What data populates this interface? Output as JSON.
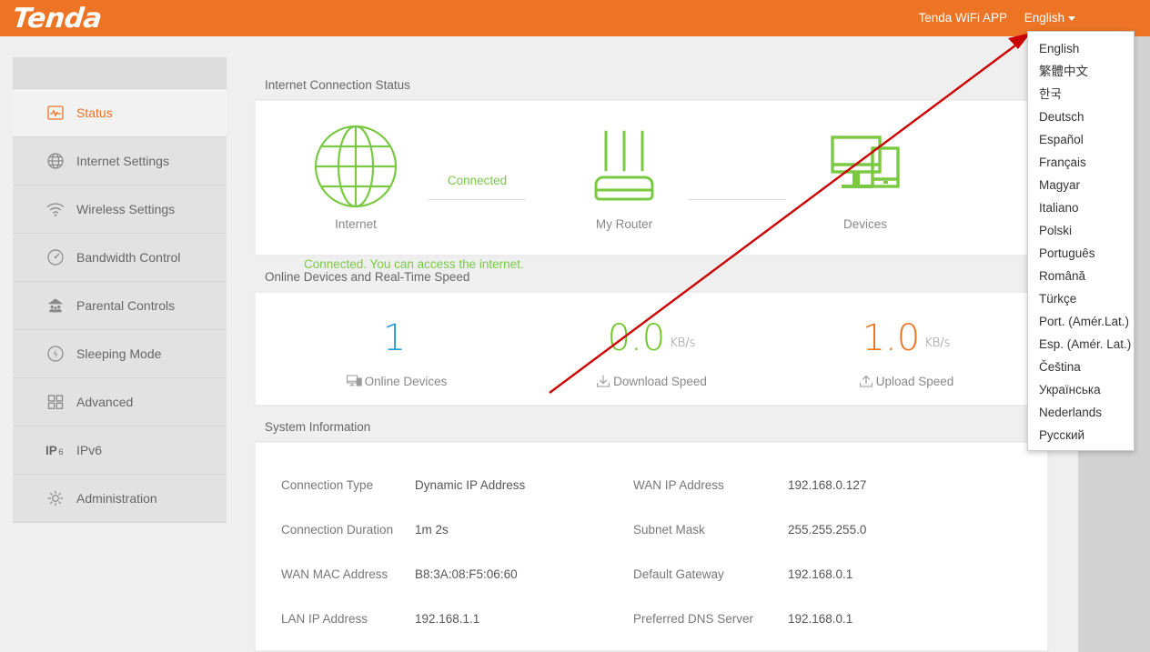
{
  "header": {
    "logo": "Tenda",
    "app_link": "Tenda WiFi APP",
    "language_current": "English"
  },
  "language_menu": {
    "items": [
      "English",
      "繁體中文",
      "한국",
      "Deutsch",
      "Español",
      "Français",
      "Magyar",
      "Italiano",
      "Polski",
      "Português",
      "Română",
      "Türkçe",
      "Port. (Amér.Lat.)",
      "Esp. (Amér. Lat.)",
      "Čeština",
      "Українська",
      "Nederlands",
      "Русский"
    ]
  },
  "sidebar": {
    "items": [
      {
        "label": "Status",
        "icon": "status-chart-icon",
        "active": true
      },
      {
        "label": "Internet Settings",
        "icon": "globe-icon",
        "active": false
      },
      {
        "label": "Wireless Settings",
        "icon": "wifi-icon",
        "active": false
      },
      {
        "label": "Bandwidth Control",
        "icon": "gauge-icon",
        "active": false
      },
      {
        "label": "Parental Controls",
        "icon": "family-icon",
        "active": false
      },
      {
        "label": "Sleeping Mode",
        "icon": "power-moon-icon",
        "active": false
      },
      {
        "label": "Advanced",
        "icon": "grid-squares-icon",
        "active": false
      },
      {
        "label": "IPv6",
        "icon": "ipv6-icon",
        "active": false
      },
      {
        "label": "Administration",
        "icon": "gear-icon",
        "active": false
      }
    ]
  },
  "connection_status": {
    "section_title": "Internet Connection Status",
    "nodes": [
      {
        "label": "Internet",
        "icon": "globe-icon"
      },
      {
        "label": "My Router",
        "icon": "router-icon"
      },
      {
        "label": "Devices",
        "icon": "devices-icon"
      }
    ],
    "link_status": "Connected",
    "note": "Connected. You can access the internet.",
    "accent_color": "#7ac943"
  },
  "realtime": {
    "section_title": "Online Devices and Real-Time Speed",
    "metrics": [
      {
        "value": "1",
        "unit": "",
        "label": "Online Devices",
        "icon": "devices-small-icon",
        "color": "#2b9ad6"
      },
      {
        "value": "0.0",
        "unit": "KB/s",
        "label": "Download Speed",
        "icon": "download-icon",
        "color": "#6fc62a"
      },
      {
        "value": "1.0",
        "unit": "KB/s",
        "label": "Upload Speed",
        "icon": "upload-icon",
        "color": "#ec7424"
      }
    ]
  },
  "system_information": {
    "section_title": "System Information",
    "rows": [
      {
        "key": "Connection Type",
        "value": "Dynamic IP Address",
        "key2": "WAN IP Address",
        "value2": "192.168.0.127"
      },
      {
        "key": "Connection Duration",
        "value": "1m 2s",
        "key2": "Subnet Mask",
        "value2": "255.255.255.0"
      },
      {
        "key": "WAN MAC Address",
        "value": "B8:3A:08:F5:06:60",
        "key2": "Default Gateway",
        "value2": "192.168.0.1"
      },
      {
        "key": "LAN IP Address",
        "value": "192.168.1.1",
        "key2": "Preferred DNS Server",
        "value2": "192.168.0.1"
      }
    ]
  },
  "annotation": {
    "arrow_color": "#cc0000",
    "arrow_from": "604,432",
    "arrow_to": "1131,38"
  },
  "colors": {
    "brand_orange": "#ec7424",
    "green": "#7ac943",
    "blue": "#2b9ad6",
    "page_bg": "#efefef",
    "sidebar_bg": "#e2e2e2"
  }
}
